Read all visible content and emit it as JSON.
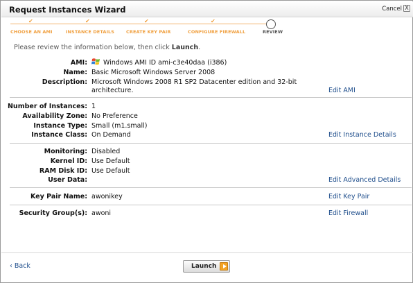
{
  "window": {
    "title": "Request Instances Wizard",
    "cancel_label": "Cancel",
    "cancel_x": "X"
  },
  "steps": [
    {
      "label": "CHOOSE AN AMI"
    },
    {
      "label": "INSTANCE DETAILS"
    },
    {
      "label": "CREATE KEY PAIR"
    },
    {
      "label": "CONFIGURE FIREWALL"
    },
    {
      "label": "REVIEW"
    }
  ],
  "intro": {
    "text": "Please review the information below, then click ",
    "emph": "Launch",
    "end": "."
  },
  "ami": {
    "label": "AMI:",
    "value": "Windows AMI ID ami-c3e40daa (i386)",
    "name_label": "Name:",
    "name_value": "Basic Microsoft Windows Server 2008",
    "desc_label": "Description:",
    "desc_line1": "Microsoft Windows 2008 R1 SP2 Datacenter edition and 32-bit",
    "desc_line2": "architecture.",
    "edit_label": "Edit AMI"
  },
  "instance": {
    "num_label": "Number of Instances:",
    "num_value": "1",
    "az_label": "Availability Zone:",
    "az_value": "No Preference",
    "type_label": "Instance Type:",
    "type_value": "Small (m1.small)",
    "class_label": "Instance Class:",
    "class_value": "On Demand",
    "edit_label": "Edit Instance Details"
  },
  "advanced": {
    "mon_label": "Monitoring:",
    "mon_value": "Disabled",
    "kernel_label": "Kernel ID:",
    "kernel_value": "Use Default",
    "ram_label": "RAM Disk ID:",
    "ram_value": "Use Default",
    "user_label": "User Data:",
    "edit_label": "Edit Advanced Details"
  },
  "keypair": {
    "label": "Key Pair Name:",
    "value": "awonikey",
    "edit_label": "Edit Key Pair"
  },
  "firewall": {
    "label": "Security Group(s):",
    "value": "awoni",
    "edit_label": "Edit Firewall"
  },
  "footer": {
    "back_label": "Back",
    "back_arrow": "‹",
    "launch_label": "Launch"
  }
}
